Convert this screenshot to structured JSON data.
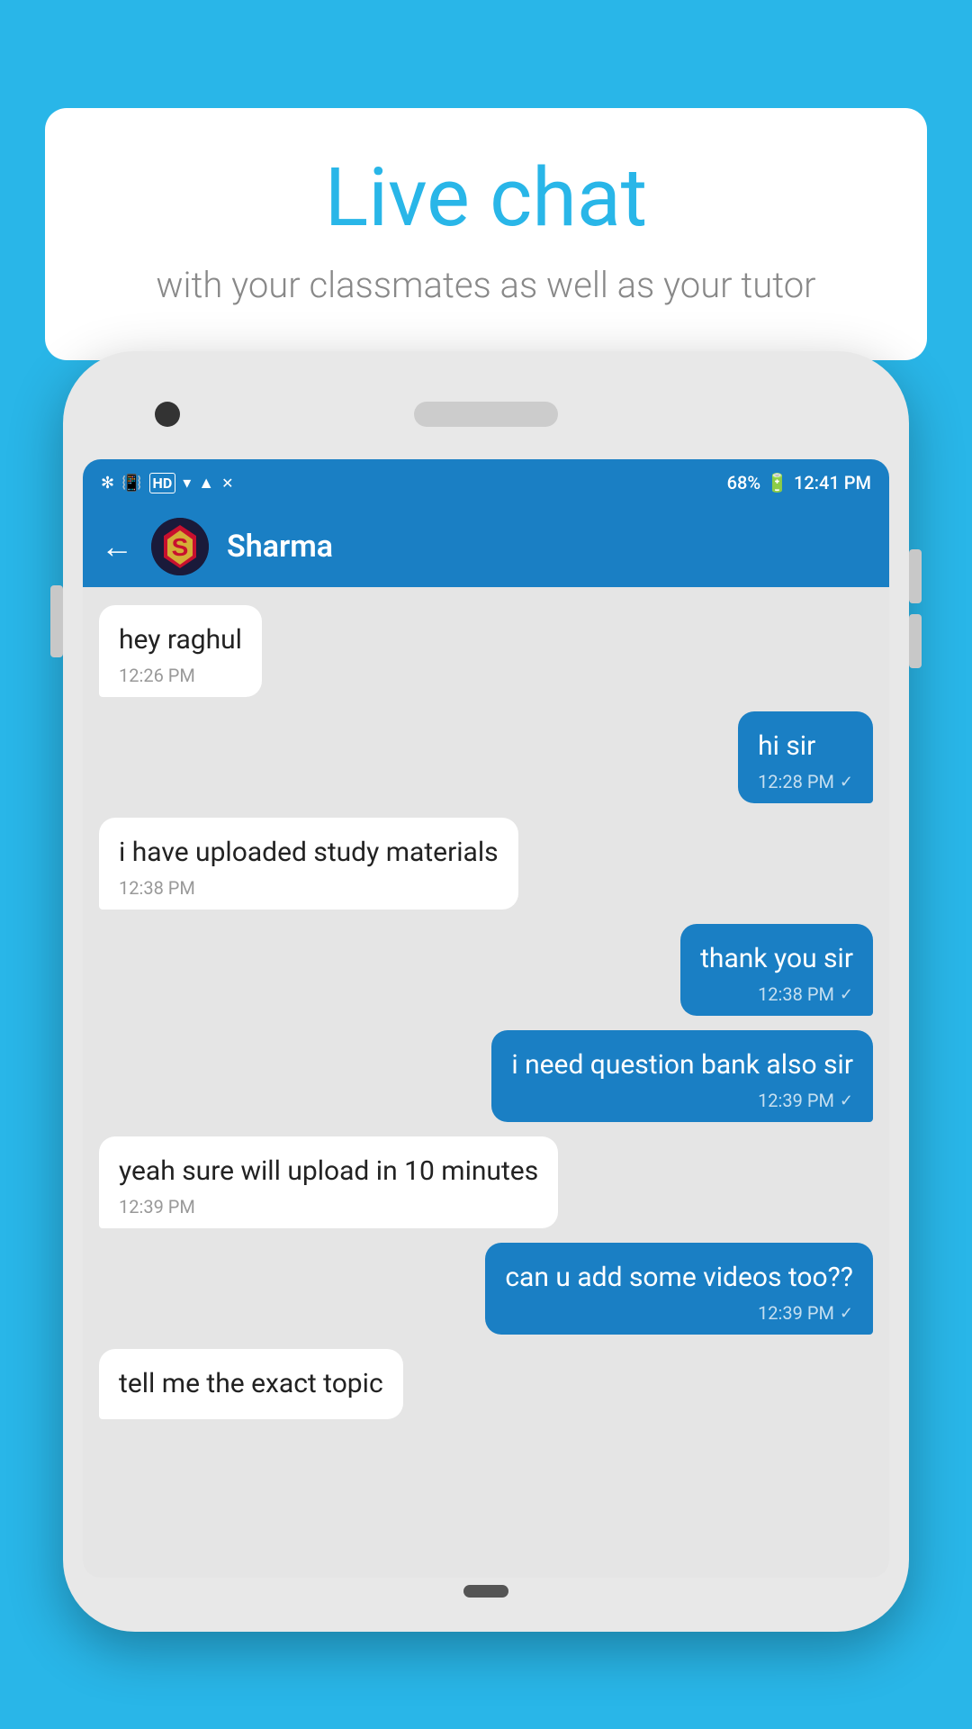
{
  "background_color": "#29b6e8",
  "bubble": {
    "title": "Live chat",
    "subtitle": "with your classmates as well as your tutor"
  },
  "phone": {
    "status_bar": {
      "left_icons": "✻  📳 HD ▲ ▾ ✕",
      "battery_percent": "68%",
      "time": "12:41 PM"
    },
    "header": {
      "back_label": "←",
      "contact_name": "Sharma"
    },
    "messages": [
      {
        "id": "msg1",
        "type": "received",
        "text": "hey raghul",
        "time": "12:26 PM",
        "check": ""
      },
      {
        "id": "msg2",
        "type": "sent",
        "text": "hi sir",
        "time": "12:28 PM",
        "check": "✓"
      },
      {
        "id": "msg3",
        "type": "received",
        "text": "i have uploaded study materials",
        "time": "12:38 PM",
        "check": ""
      },
      {
        "id": "msg4",
        "type": "sent",
        "text": "thank you sir",
        "time": "12:38 PM",
        "check": "✓"
      },
      {
        "id": "msg5",
        "type": "sent",
        "text": "i need question bank also sir",
        "time": "12:39 PM",
        "check": "✓"
      },
      {
        "id": "msg6",
        "type": "received",
        "text": "yeah sure will upload in 10 minutes",
        "time": "12:39 PM",
        "check": ""
      },
      {
        "id": "msg7",
        "type": "sent",
        "text": "can u add some videos too??",
        "time": "12:39 PM",
        "check": "✓"
      },
      {
        "id": "msg8",
        "type": "received",
        "text": "tell me the exact topic",
        "time": "",
        "check": ""
      }
    ]
  }
}
